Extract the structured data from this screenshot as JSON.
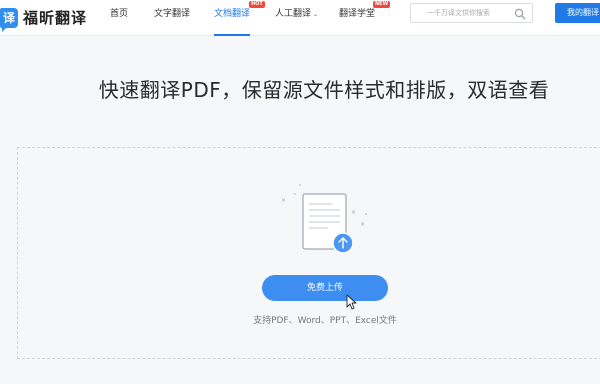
{
  "brand": {
    "logo_char": "译",
    "name": "福昕翻译"
  },
  "nav": {
    "home": "首页",
    "text_translate": "文字翻译",
    "doc_translate": "文档翻译",
    "doc_badge": "HOT",
    "human_translate": "人工翻译",
    "academy": "翻译学堂",
    "academy_badge": "NEW"
  },
  "search": {
    "placeholder": "一千万译文供你搜索",
    "icon": "search-icon"
  },
  "my_translate_label": "我的翻译",
  "headline": "快速翻译PDF，保留源文件样式和排版，双语查看",
  "upload": {
    "button_label": "免费上传",
    "supported": "支持PDF、Word、PPT、Excel文件"
  },
  "colors": {
    "accent": "#1f7ae6",
    "button": "#3d8ef0",
    "badge": "#f0483e"
  }
}
